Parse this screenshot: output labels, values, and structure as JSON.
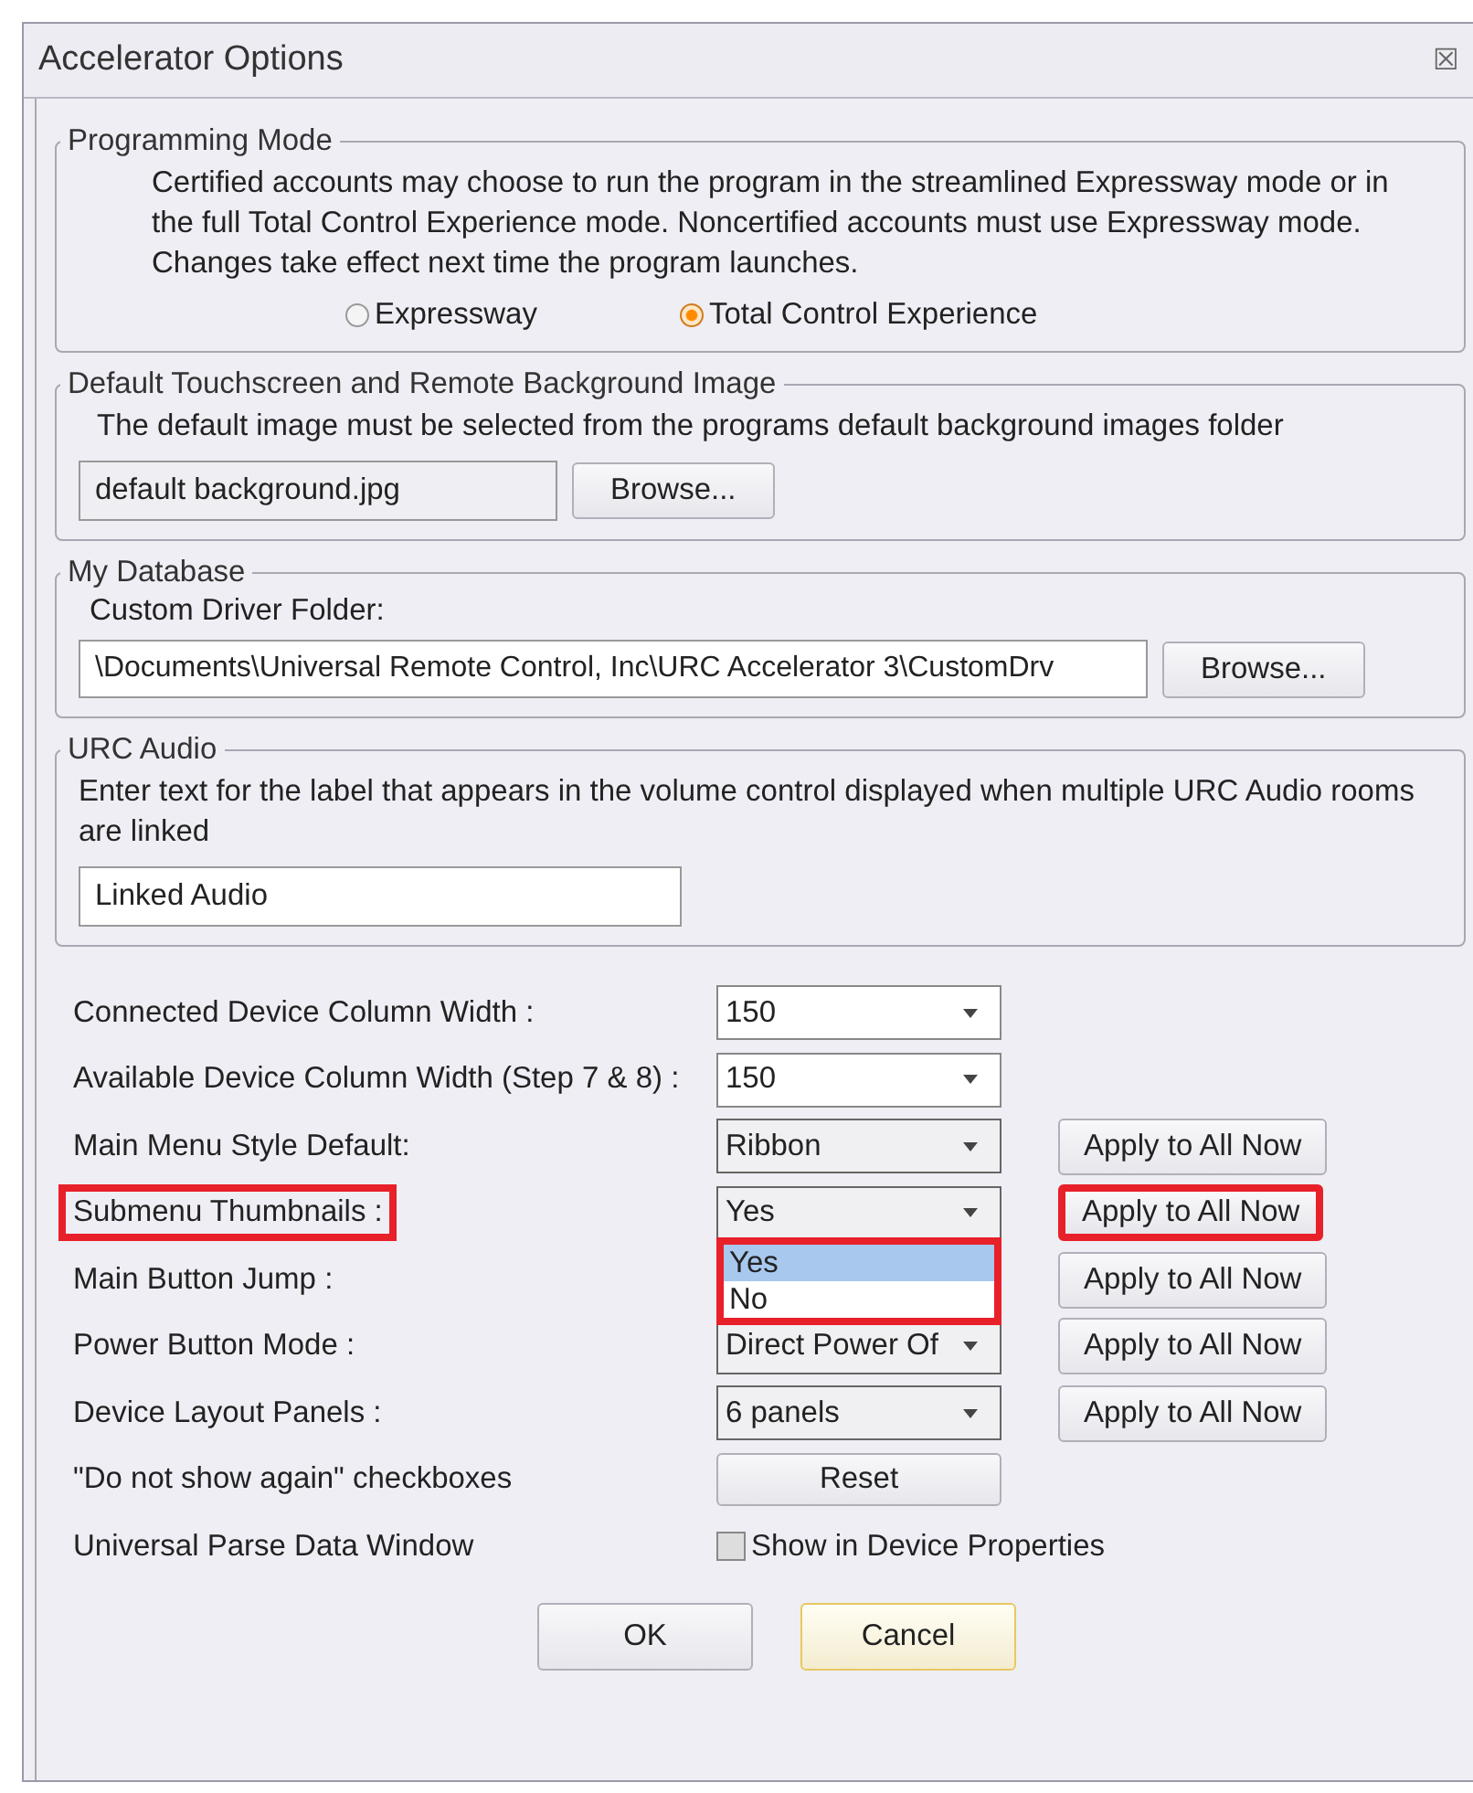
{
  "window": {
    "title": "Accelerator Options",
    "close": "☒"
  },
  "programming_mode": {
    "title": "Programming Mode",
    "text": "Certified accounts may choose to run the program in the streamlined Expressway mode or in the full Total Control Experience mode. Noncertified accounts must use Expressway mode. Changes take effect next time the program launches.",
    "options": [
      {
        "label": "Expressway",
        "selected": false
      },
      {
        "label": "Total Control Experience",
        "selected": true
      }
    ]
  },
  "background_image": {
    "title": "Default Touchscreen and Remote Background Image",
    "text": "The default image must be selected from the programs default background images folder",
    "value": "default background.jpg",
    "button": "Browse..."
  },
  "my_database": {
    "title": "My Database",
    "label": "Custom Driver Folder:",
    "value": "\\Documents\\Universal Remote Control, Inc\\URC Accelerator 3\\CustomDrv",
    "button": "Browse..."
  },
  "urc_audio": {
    "title": "URC Audio",
    "text": "Enter text for the label that appears in the volume control displayed when multiple URC Audio rooms are linked",
    "value": "Linked Audio"
  },
  "settings": [
    {
      "label": "Connected Device Column Width :",
      "kind": "combo",
      "value": "150",
      "disabled": false,
      "highlighted": false
    },
    {
      "label": "Available Device Column Width (Step 7 & 8) :",
      "kind": "combo",
      "value": "150",
      "disabled": false,
      "highlighted": false
    },
    {
      "label": "Main Menu Style Default:",
      "kind": "combo",
      "value": "Ribbon",
      "disabled": true,
      "button": "Apply to All Now",
      "highlighted": false
    },
    {
      "label": "Submenu Thumbnails :",
      "kind": "combo",
      "value": "Yes",
      "disabled": true,
      "button": "Apply to All Now",
      "highlighted": true,
      "dropdown": [
        {
          "label": "Yes",
          "selected": true
        },
        {
          "label": "No",
          "selected": false
        }
      ]
    },
    {
      "label": "Main Button Jump :",
      "kind": "combo",
      "button": "Apply to All Now",
      "highlighted": false
    },
    {
      "label": "Power Button Mode :",
      "kind": "combo",
      "value": "Direct Power Of",
      "disabled": true,
      "button": "Apply to All Now",
      "highlighted": false
    },
    {
      "label": "Device Layout Panels :",
      "kind": "combo",
      "value": "6 panels",
      "disabled": true,
      "button": "Apply to All Now",
      "highlighted": false
    },
    {
      "label": "\"Do not show again\" checkboxes",
      "kind": "button",
      "value": "Reset",
      "highlighted": false
    },
    {
      "label": "Universal Parse Data Window",
      "kind": "checkbox",
      "value": "Show in Device Properties",
      "checked": false,
      "highlighted": false
    }
  ],
  "buttons": [
    {
      "label": "OK",
      "focused": false
    },
    {
      "label": "Cancel",
      "focused": true
    }
  ]
}
